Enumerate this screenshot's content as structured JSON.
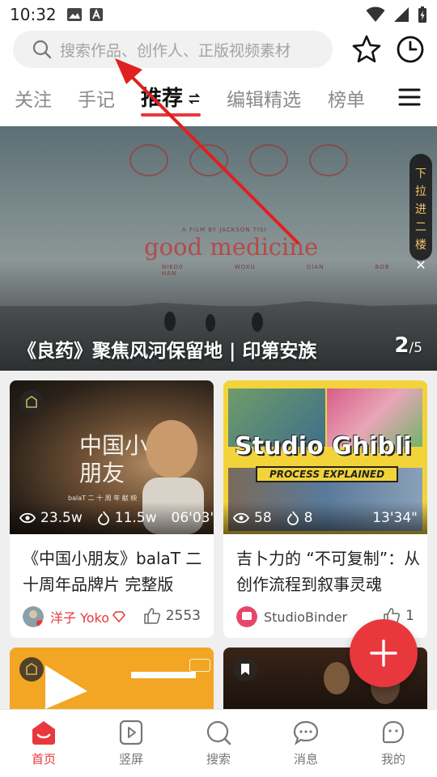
{
  "status_bar": {
    "time": "10:32"
  },
  "search": {
    "placeholder": "搜索作品、创作人、正版视频素材"
  },
  "tabs": [
    {
      "label": "关注"
    },
    {
      "label": "手记"
    },
    {
      "label": "推荐"
    },
    {
      "label": "编辑精选"
    },
    {
      "label": "榜单"
    }
  ],
  "banner": {
    "caption": "《良药》聚焦风河保留地 | 印第安族",
    "page_current": "2",
    "page_total": "/5",
    "poster_title": "good medicine",
    "poster_credit": "A FILM BY JACKSON TISI",
    "poster_names": "NIKO0 WOXU    DIAN BOB HAN",
    "pulldown_chars": [
      "下",
      "拉",
      "进",
      "二",
      "楼"
    ],
    "pulldown_close": "✕"
  },
  "cards": [
    {
      "views": "23.5w",
      "plays": "11.5w",
      "duration": "06'03\"",
      "title": "《中国小朋友》balaT 二十周年品牌片 完整版",
      "author": "洋子 Yoko",
      "likes": "2553",
      "thumb_text": "中国小朋友",
      "thumb_sub": "balaT 二 十 周 年 献 映"
    },
    {
      "views": "58",
      "plays": "8",
      "duration": "13'34\"",
      "title": "吉卜力的 “不可复制”：从创作流程到叙事灵魂",
      "author": "StudioBinder",
      "likes": "1",
      "thumb_text": "Studio Ghibli",
      "thumb_sub": "PROCESS EXPLAINED"
    }
  ],
  "bottom_nav": [
    {
      "label": "首页"
    },
    {
      "label": "竖屏"
    },
    {
      "label": "搜索"
    },
    {
      "label": "消息"
    },
    {
      "label": "我的"
    }
  ],
  "colors": {
    "accent": "#e8383d",
    "annotation_arrow": "#e02020"
  }
}
